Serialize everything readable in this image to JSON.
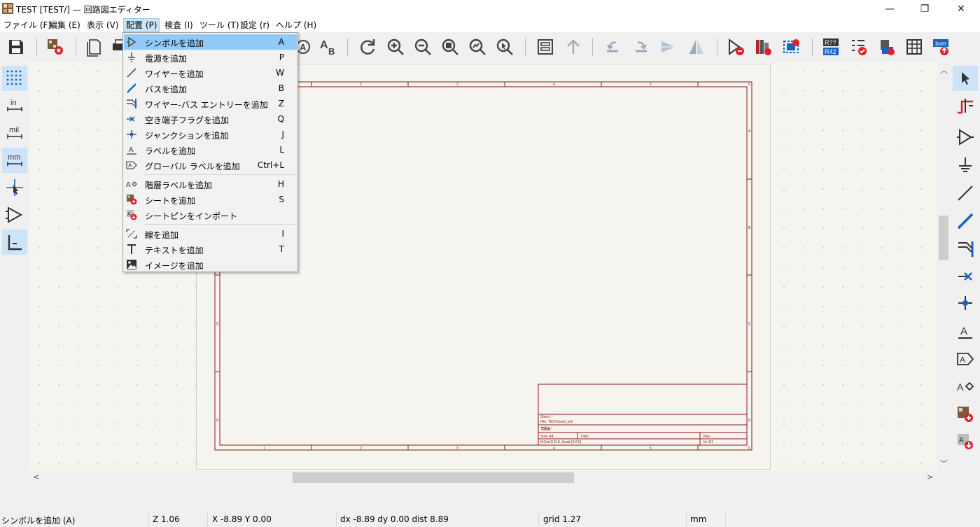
{
  "window": {
    "title": "TEST [TEST/] — 回路図エディター",
    "minimize_glyph": "—",
    "restore_glyph": "❐",
    "close_glyph": "✕"
  },
  "menubar": {
    "items": [
      "ファイル (F)",
      "編集 (E)",
      "表示 (V)",
      "配置 (P)",
      "検査 (I)",
      "ツール (T)",
      "設定 (r)",
      "ヘルプ (H)"
    ],
    "active_index": 3
  },
  "place_menu": {
    "items": [
      {
        "label": "シンボルを追加",
        "shortcut": "A",
        "icon": "symbol-icon",
        "highlighted": true
      },
      {
        "label": "電源を追加",
        "shortcut": "P",
        "icon": "power-icon"
      },
      {
        "label": "ワイヤーを追加",
        "shortcut": "W",
        "icon": "wire-icon"
      },
      {
        "label": "バスを追加",
        "shortcut": "B",
        "icon": "bus-icon"
      },
      {
        "label": "ワイヤー-バス エントリーを追加",
        "shortcut": "Z",
        "icon": "bus-entry-icon"
      },
      {
        "label": "空き端子フラグを追加",
        "shortcut": "Q",
        "icon": "no-connect-icon"
      },
      {
        "label": "ジャンクションを追加",
        "shortcut": "J",
        "icon": "junction-icon"
      },
      {
        "label": "ラベルを追加",
        "shortcut": "L",
        "icon": "label-icon"
      },
      {
        "label": "グローバル ラベルを追加",
        "shortcut": "Ctrl+L",
        "icon": "global-label-icon"
      },
      {
        "label": "階層ラベルを追加",
        "shortcut": "H",
        "icon": "hier-label-icon"
      },
      {
        "label": "シートを追加",
        "shortcut": "S",
        "icon": "sheet-icon"
      },
      {
        "label": "シートピンをインポート",
        "shortcut": "",
        "icon": "import-sheet-pin-icon"
      },
      {
        "label": "線を追加",
        "shortcut": "I",
        "icon": "line-icon"
      },
      {
        "label": "テキストを追加",
        "shortcut": "T",
        "icon": "text-icon"
      },
      {
        "label": "イメージを追加",
        "shortcut": "",
        "icon": "image-icon"
      }
    ]
  },
  "left_toolbar": {
    "unit_in": "in",
    "unit_mil": "mil",
    "unit_mm": "mm"
  },
  "toolbar": {
    "text_tool_label": "AB"
  },
  "title_block": {
    "sheet": "Sheet: /",
    "file": "File: TEST.kicad_sch",
    "title": "Title:",
    "size": "Size: A4",
    "date": "Date:",
    "rev": "Rev:",
    "kicad": "KiCad E.D.A.  kicad (6.0.5)",
    "id": "Id: 1/1"
  },
  "frame": {
    "col_numbers": [
      "1",
      "2",
      "3",
      "4",
      "5",
      "6"
    ],
    "row_letters": [
      "A",
      "B",
      "C",
      "D"
    ]
  },
  "statusbar": {
    "message": "シンボルを追加  (A)",
    "zoom": "Z 1.06",
    "xy": "X -8.89  Y 0.00",
    "delta": "dx -8.89  dy 0.00  dist 8.89",
    "grid": "grid 1.27",
    "units": "mm"
  },
  "colors": {
    "frame": "#8b1a1a",
    "canvas": "#f5f4ef",
    "highlight": "#91c9f7",
    "accent_blue": "#1565c0",
    "accent_red": "#e0202a"
  }
}
